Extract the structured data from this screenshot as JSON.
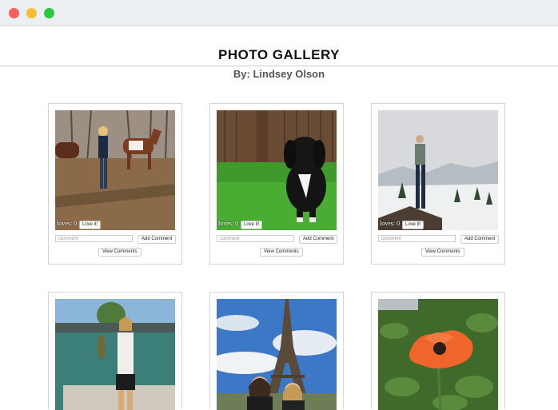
{
  "window": {
    "controls": [
      "close",
      "minimize",
      "zoom"
    ]
  },
  "gallery": {
    "title": "PHOTO GALLERY",
    "author": "By: Lindsey Olson"
  },
  "cards": [
    {
      "loves_text": "loves: 0",
      "love_label": "Love it!",
      "comment_placeholder": "comment",
      "add_label": "Add Comment",
      "view_label": "View Comments"
    },
    {
      "loves_text": "loves: 0",
      "love_label": "Love it!",
      "comment_placeholder": "comment",
      "add_label": "Add Comment",
      "view_label": "View Comments"
    },
    {
      "loves_text": "loves: 0",
      "love_label": "Love it!",
      "comment_placeholder": "comment",
      "add_label": "Add Comment",
      "view_label": "View Comments"
    }
  ],
  "colors": {
    "close": "#ff5f57",
    "minimize": "#febc2e",
    "zoom": "#28c840"
  }
}
